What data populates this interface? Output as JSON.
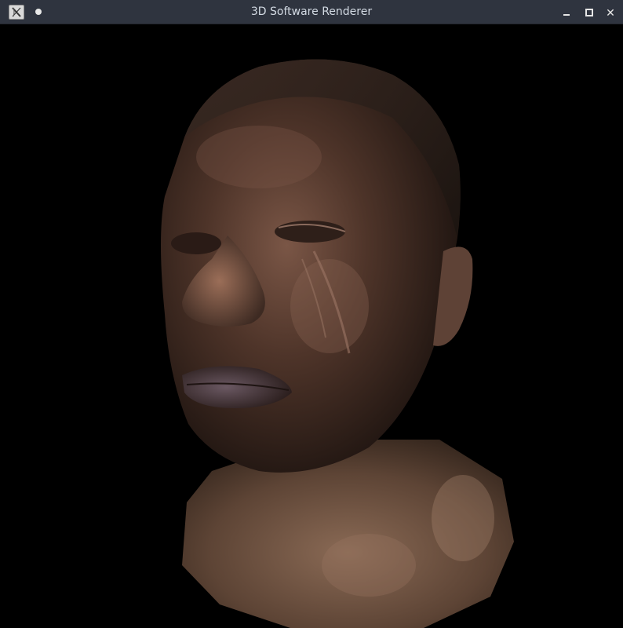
{
  "window": {
    "title": "3D Software Renderer",
    "icons": {
      "app": "x-app-icon",
      "sticky": "dot-icon",
      "minimize": "minimize-icon",
      "maximize": "maximize-icon",
      "close": "close-icon"
    },
    "close_glyph": "✕"
  },
  "viewport": {
    "background": "#000000",
    "content": "rendered-head-model"
  },
  "colors": {
    "titlebar": "#2f343f",
    "title_text": "#d3dae3",
    "skin_dark": "#2b1d17",
    "skin_mid": "#5a3f33",
    "skin_light": "#8a6452",
    "neck": "#6e5140"
  }
}
